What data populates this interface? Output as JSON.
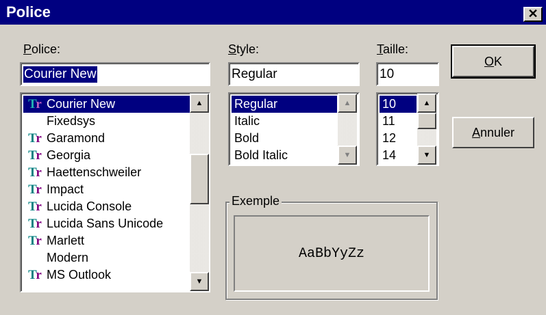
{
  "window": {
    "title": "Police",
    "close_glyph": "✕"
  },
  "font": {
    "label_prefix": "P",
    "label_rest": "olice:",
    "value": "Courier New",
    "items": [
      {
        "name": "Courier New",
        "icon": "truetype-icon",
        "glyph": "Tr",
        "selected": true
      },
      {
        "name": "Fixedsys",
        "icon": "",
        "glyph": "",
        "selected": false
      },
      {
        "name": "Garamond",
        "icon": "truetype-icon",
        "glyph": "Tr",
        "selected": false
      },
      {
        "name": "Georgia",
        "icon": "truetype-icon",
        "glyph": "Tr",
        "selected": false
      },
      {
        "name": "Haettenschweiler",
        "icon": "truetype-icon",
        "glyph": "Tr",
        "selected": false
      },
      {
        "name": "Impact",
        "icon": "truetype-icon",
        "glyph": "Tr",
        "selected": false
      },
      {
        "name": "Lucida Console",
        "icon": "truetype-icon",
        "glyph": "Tr",
        "selected": false
      },
      {
        "name": "Lucida Sans Unicode",
        "icon": "truetype-icon",
        "glyph": "Tr",
        "selected": false
      },
      {
        "name": "Marlett",
        "icon": "truetype-icon",
        "glyph": "Tr",
        "selected": false
      },
      {
        "name": "Modern",
        "icon": "",
        "glyph": "",
        "selected": false
      },
      {
        "name": "MS Outlook",
        "icon": "truetype-icon",
        "glyph": "Tr",
        "selected": false
      }
    ]
  },
  "style": {
    "label_prefix": "S",
    "label_rest": "tyle:",
    "value": "Regular",
    "items": [
      {
        "name": "Regular",
        "selected": true
      },
      {
        "name": "Italic",
        "selected": false
      },
      {
        "name": "Bold",
        "selected": false
      },
      {
        "name": "Bold Italic",
        "selected": false
      }
    ]
  },
  "size": {
    "label_prefix": "T",
    "label_rest": "aille:",
    "value": "10",
    "items": [
      {
        "name": "10",
        "selected": true
      },
      {
        "name": "11",
        "selected": false
      },
      {
        "name": "12",
        "selected": false
      },
      {
        "name": "14",
        "selected": false
      }
    ]
  },
  "buttons": {
    "ok_prefix": "O",
    "ok_rest": "K",
    "cancel_prefix": "A",
    "cancel_rest": "nnuler"
  },
  "sample": {
    "label": "Exemple",
    "text": "AaBbYyZz"
  },
  "scroll": {
    "up_glyph": "▲",
    "down_glyph": "▼"
  },
  "colors": {
    "titlebar": "#000080",
    "face": "#d4d0c8",
    "selection": "#000080",
    "truetype_teal": "#008080",
    "truetype_purple": "#800080"
  }
}
